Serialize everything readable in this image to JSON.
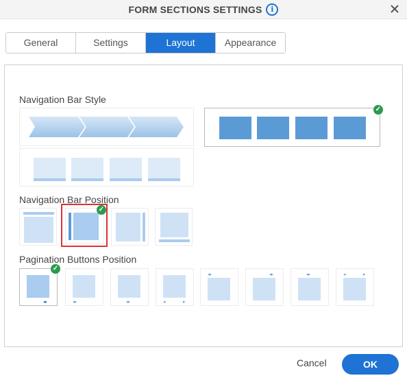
{
  "dialog": {
    "title": "FORM SECTIONS SETTINGS",
    "info_icon": "info-icon",
    "close_icon": "close-icon"
  },
  "tabs": [
    {
      "label": "General",
      "active": false
    },
    {
      "label": "Settings",
      "active": false
    },
    {
      "label": "Layout",
      "active": true
    },
    {
      "label": "Appearance",
      "active": false
    }
  ],
  "sections": {
    "nav_bar_style": {
      "label": "Navigation Bar Style",
      "options": [
        "arrows",
        "tabs-with-underline",
        "blocks"
      ],
      "selected": "blocks"
    },
    "nav_bar_position": {
      "label": "Navigation Bar Position",
      "options": [
        "top",
        "left",
        "right",
        "bottom"
      ],
      "selected": "left"
    },
    "pagination_position": {
      "label": "Pagination Buttons Position",
      "options": [
        "bottom-right",
        "bottom-left",
        "bottom-center",
        "bottom-left-split",
        "top-left",
        "top-right",
        "top-center",
        "top-split"
      ],
      "selected": "bottom-right"
    }
  },
  "footer": {
    "cancel_label": "Cancel",
    "ok_label": "OK"
  },
  "colors": {
    "accent": "#1e73d4",
    "check": "#2c9a4f",
    "highlight": "#e03131",
    "block": "#5b9bd5",
    "light_block": "#cfe2f5"
  }
}
